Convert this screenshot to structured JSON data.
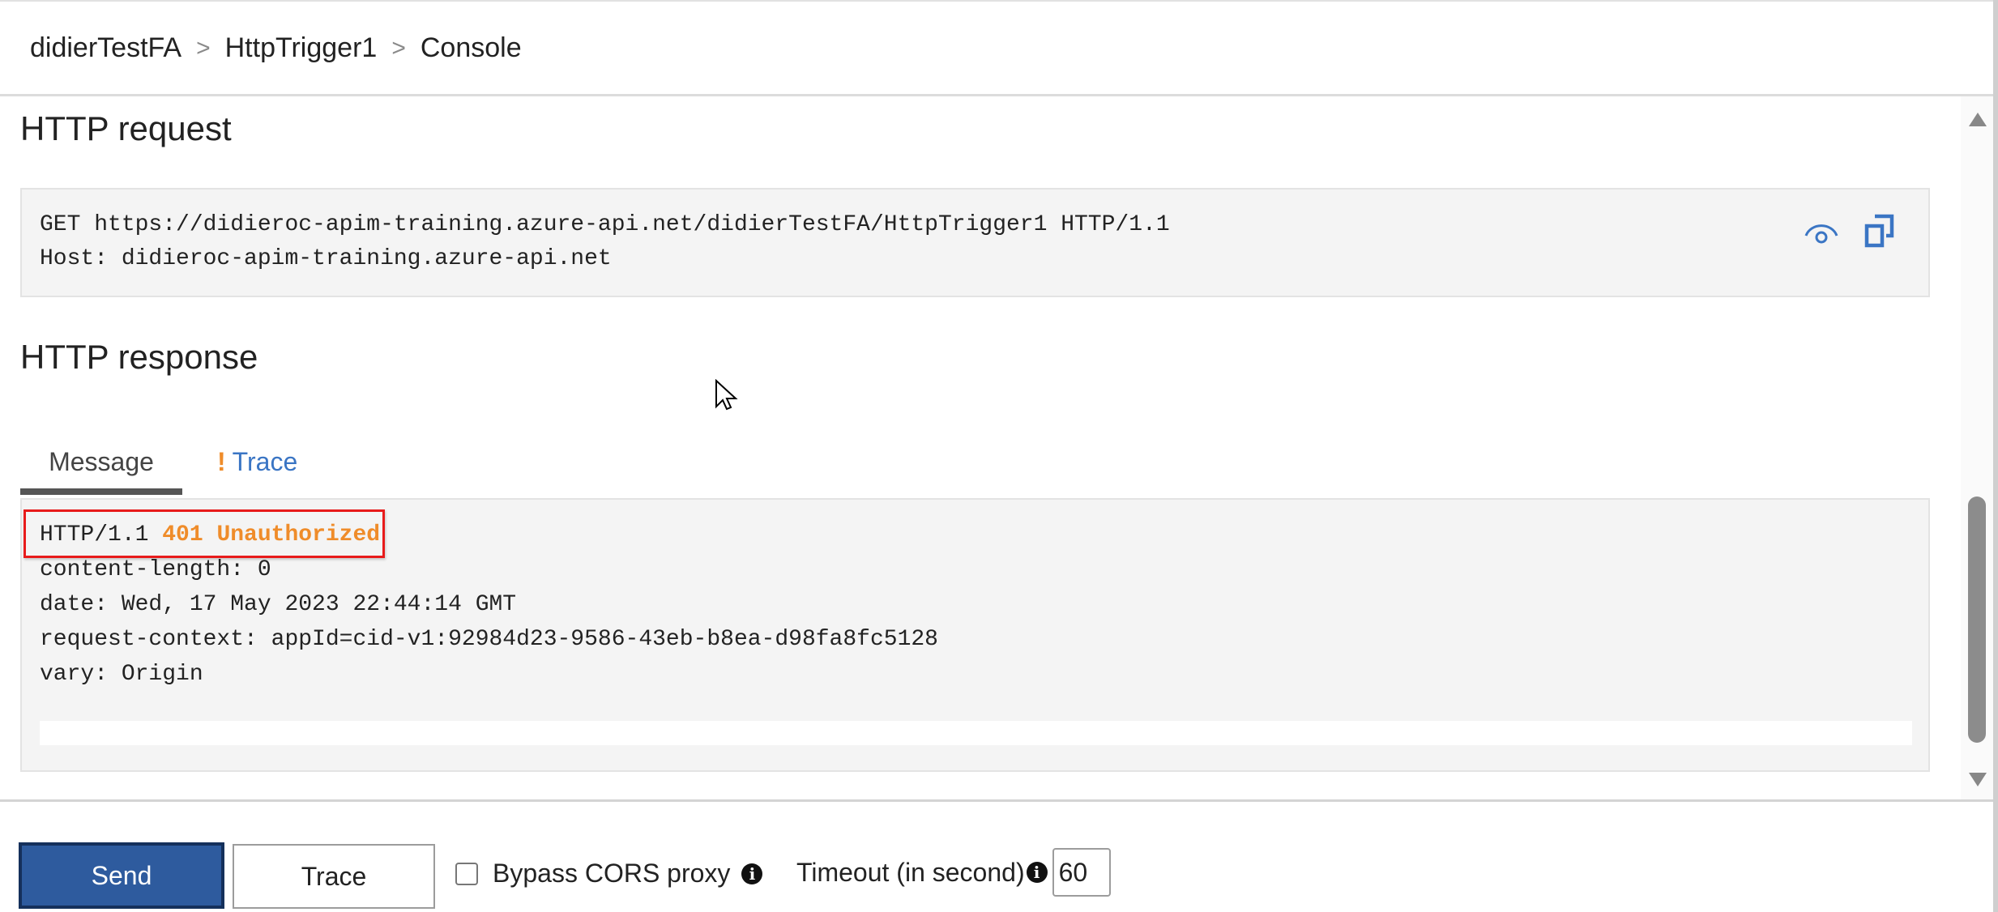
{
  "breadcrumb": {
    "items": [
      "didierTestFA",
      "HttpTrigger1",
      "Console"
    ],
    "separator": ">"
  },
  "request": {
    "title": "HTTP request",
    "lines": [
      "GET https://didieroc-apim-training.azure-api.net/didierTestFA/HttpTrigger1 HTTP/1.1",
      "Host: didieroc-apim-training.azure-api.net"
    ],
    "icons": [
      "eye-icon",
      "copy-icon"
    ]
  },
  "response": {
    "title": "HTTP response",
    "tabs": [
      {
        "label": "Message",
        "active": true
      },
      {
        "label": "Trace",
        "warning": "!"
      }
    ],
    "status_prefix": "HTTP/1.1 ",
    "status_code": "401 Unauthorized",
    "headers": [
      "content-length: 0",
      "date: Wed, 17 May 2023 22:44:14 GMT",
      "request-context: appId=cid-v1:92984d23-9586-43eb-b8ea-d98fa8fc5128",
      "vary: Origin"
    ],
    "status_color": "#ef8c2a"
  },
  "footer": {
    "send_label": "Send",
    "trace_label": "Trace",
    "bypass_cors_label": "Bypass CORS proxy",
    "bypass_cors_checked": false,
    "timeout_label": "Timeout (in second)",
    "timeout_value": "60",
    "info_glyph": "i"
  },
  "colors": {
    "accent_blue": "#2e5b9e",
    "link_blue": "#3a75c4",
    "warning_orange": "#ef8c2a",
    "highlight_red": "#e81b1b"
  }
}
